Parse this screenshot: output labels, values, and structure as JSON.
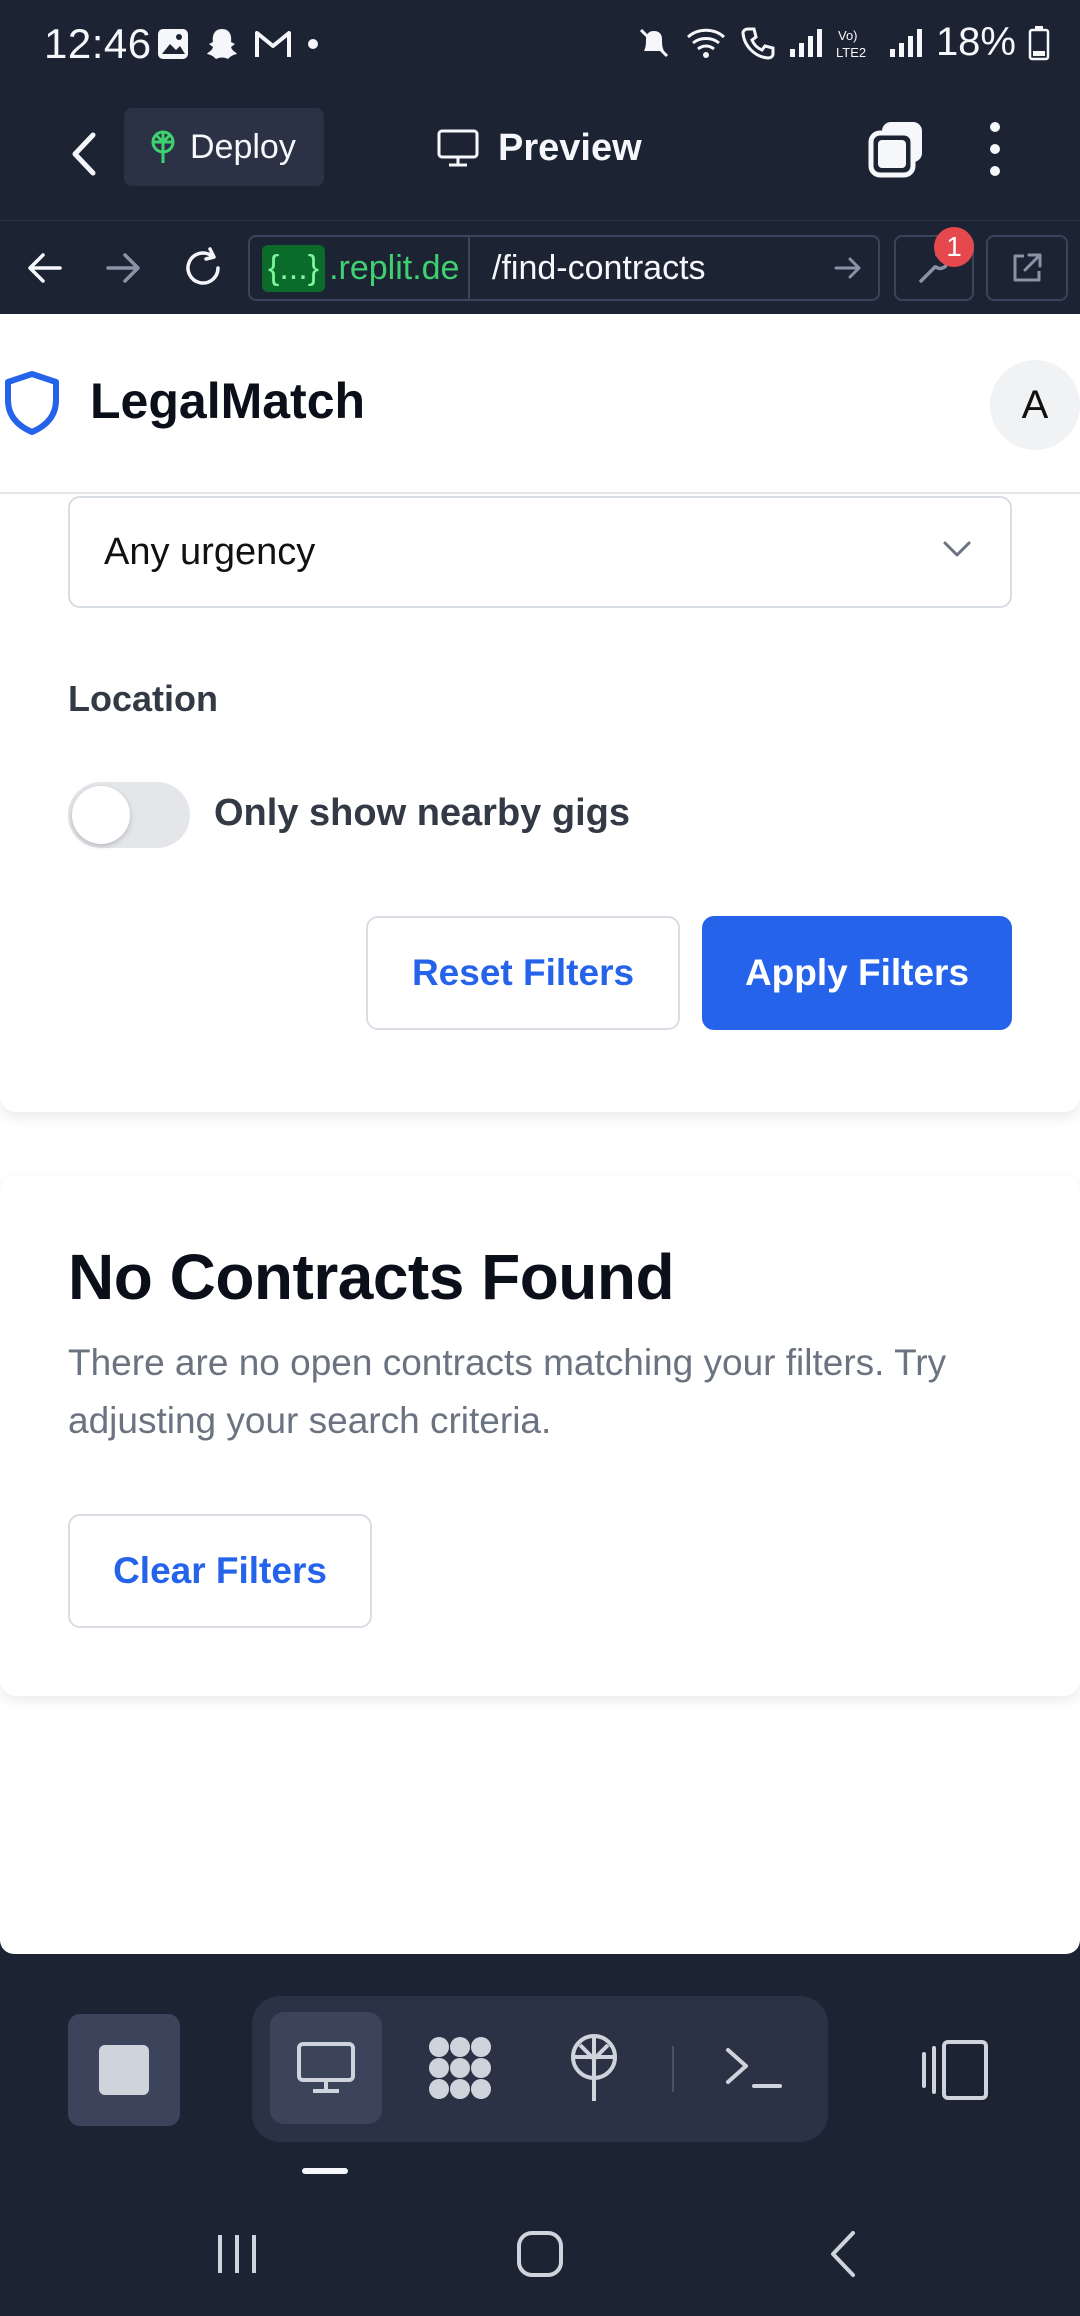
{
  "status_bar": {
    "time": "12:46",
    "battery": "18%"
  },
  "top_bar": {
    "deploy_label": "Deploy",
    "preview_label": "Preview"
  },
  "url_bar": {
    "host_badge": "{...}",
    "host": ".replit.de",
    "path": "/find-contracts",
    "devtools_badge_count": "1"
  },
  "app": {
    "brand_name": "LegalMatch",
    "avatar_initial": "A",
    "accent_color": "#2563eb"
  },
  "filters": {
    "urgency_value": "Any urgency",
    "location_label": "Location",
    "nearby_toggle_label": "Only show nearby gigs",
    "nearby_toggle_on": false,
    "reset_label": "Reset Filters",
    "apply_label": "Apply Filters"
  },
  "empty_state": {
    "title": "No Contracts Found",
    "description": "There are no open contracts matching your filters. Try adjusting your search criteria.",
    "clear_label": "Clear Filters"
  },
  "bottom_toolbar": {
    "tools": [
      "preview-icon",
      "workspace-icon",
      "deploy-icon",
      "console-icon"
    ],
    "active_tool": "preview-icon"
  },
  "icons": [
    "image-icon",
    "snapchat-icon",
    "gmail-icon",
    "mute-icon",
    "wifi-icon",
    "call-icon",
    "signal-icon",
    "battery-icon",
    "back-icon",
    "monitor-icon",
    "tabs-icon",
    "more-icon",
    "refresh-icon",
    "wrench-icon",
    "external-link-icon",
    "shield-icon",
    "chevron-down-icon",
    "stop-icon",
    "layout-icon"
  ]
}
